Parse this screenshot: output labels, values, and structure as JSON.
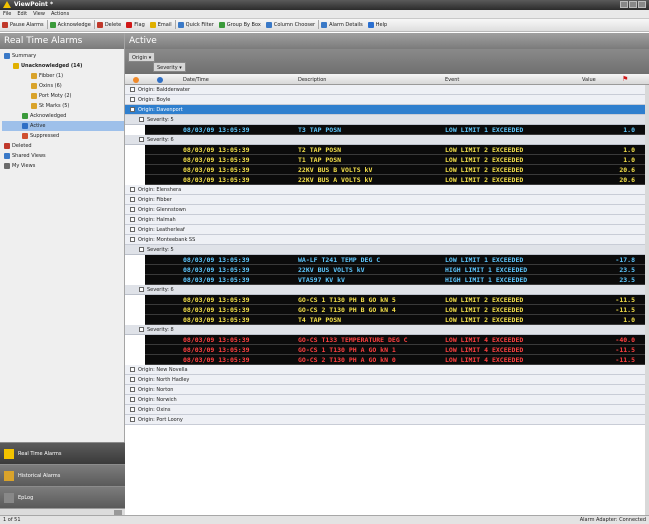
{
  "window": {
    "title": "ViewPoint *"
  },
  "menu": [
    "File",
    "Edit",
    "View",
    "Actions"
  ],
  "toolbar": [
    {
      "label": "Pause Alarms",
      "color": "#c0392b"
    },
    {
      "label": "Acknowledge",
      "color": "#3a9a3a"
    },
    {
      "label": "Delete",
      "color": "#c0392b"
    },
    {
      "label": "Flag",
      "color": "#d01818"
    },
    {
      "label": "Email",
      "color": "#e0b000"
    },
    {
      "label": "Quick Filter",
      "color": "#3a79c7"
    },
    {
      "label": "Group By Box",
      "color": "#3a9a3a"
    },
    {
      "label": "Column Chooser",
      "color": "#3a79c7"
    },
    {
      "label": "Alarm Details",
      "color": "#3a79c7"
    },
    {
      "label": "Help",
      "color": "#2a6fd0"
    }
  ],
  "left_panel": {
    "title": "Real Time Alarms",
    "tree": [
      {
        "label": "Summary",
        "indent": 0,
        "icon": "summary-icon",
        "color": "#3a79c7"
      },
      {
        "label": "Unacknowledged (14)",
        "indent": 1,
        "icon": "warning-icon",
        "color": "#e0b000",
        "bold": true
      },
      {
        "label": "Fibber (1)",
        "indent": 3,
        "icon": "folder-icon",
        "color": "#d9a32b"
      },
      {
        "label": "Oxins (6)",
        "indent": 3,
        "icon": "folder-icon",
        "color": "#d9a32b"
      },
      {
        "label": "Port Moty (2)",
        "indent": 3,
        "icon": "folder-icon",
        "color": "#d9a32b"
      },
      {
        "label": "St Marks (5)",
        "indent": 3,
        "icon": "folder-icon",
        "color": "#d9a32b"
      },
      {
        "label": "Acknowledged",
        "indent": 2,
        "icon": "check-icon",
        "color": "#3a9a3a"
      },
      {
        "label": "Active",
        "indent": 2,
        "icon": "star-icon",
        "color": "#2f6fc5",
        "selected": true
      },
      {
        "label": "Suppressed",
        "indent": 2,
        "icon": "suppressed-icon",
        "color": "#d05030"
      },
      {
        "label": "Deleted",
        "indent": 0,
        "icon": "deleted-icon",
        "color": "#c0392b"
      },
      {
        "label": "Shared Views",
        "indent": 0,
        "icon": "shared-icon",
        "color": "#3a79c7"
      },
      {
        "label": "My Views",
        "indent": 0,
        "icon": "views-icon",
        "color": "#6a6a6a"
      }
    ],
    "nav": [
      {
        "label": "Real Time Alarms",
        "icon": "warning-icon",
        "color": "#f2c200",
        "active": true
      },
      {
        "label": "Historical Alarms",
        "icon": "history-icon",
        "color": "#d9a32b"
      },
      {
        "label": "EpLog",
        "icon": "log-icon",
        "color": "#888888"
      }
    ]
  },
  "main": {
    "title": "Active",
    "group_chips": [
      "Origin",
      "Severity"
    ],
    "columns": [
      "Date/Time",
      "Description",
      "Event",
      "Value"
    ],
    "rows": [
      {
        "type": "origin",
        "label": "Origin: Baldderwater"
      },
      {
        "type": "origin",
        "label": "Origin: Boyle"
      },
      {
        "type": "origin",
        "label": "Origin: Davenport",
        "selected": true
      },
      {
        "type": "severity",
        "label": "Severity: 5"
      },
      {
        "type": "alarm",
        "datetime": "08/03/09 13:05:39",
        "desc": "T3 TAP POSN",
        "event": "LOW LIMIT 1 EXCEEDED",
        "value": "1.0",
        "color": "#5ec8ff"
      },
      {
        "type": "severity",
        "label": "Severity: 6"
      },
      {
        "type": "alarm",
        "datetime": "08/03/09 13:05:39",
        "desc": "T2 TAP POSN",
        "event": "LOW LIMIT 2 EXCEEDED",
        "value": "1.0",
        "color": "#f4e04a"
      },
      {
        "type": "alarm",
        "datetime": "08/03/09 13:05:39",
        "desc": "T1 TAP POSN",
        "event": "LOW LIMIT 2 EXCEEDED",
        "value": "1.0",
        "color": "#f4e04a"
      },
      {
        "type": "alarm",
        "datetime": "08/03/09 13:05:39",
        "desc": "22KV BUS B VOLTS kV",
        "event": "LOW LIMIT 2 EXCEEDED",
        "value": "20.6",
        "color": "#f4e04a"
      },
      {
        "type": "alarm",
        "datetime": "08/03/09 13:05:39",
        "desc": "22KV BUS A VOLTS kV",
        "event": "LOW LIMIT 2 EXCEEDED",
        "value": "20.6",
        "color": "#f4e04a"
      },
      {
        "type": "origin",
        "label": "Origin: Elenshera"
      },
      {
        "type": "origin",
        "label": "Origin: Fibber"
      },
      {
        "type": "origin",
        "label": "Origin: Glennstown"
      },
      {
        "type": "origin",
        "label": "Origin: Halmah"
      },
      {
        "type": "origin",
        "label": "Origin: Leatherleaf"
      },
      {
        "type": "origin",
        "label": "Origin: Monteebank SS"
      },
      {
        "type": "severity",
        "label": "Severity: 5"
      },
      {
        "type": "alarm",
        "datetime": "08/03/09 13:05:39",
        "desc": "WA-LF T241 TEMP DEG C",
        "event": "LOW LIMIT 1 EXCEEDED",
        "value": "-17.8",
        "color": "#5ec8ff"
      },
      {
        "type": "alarm",
        "datetime": "08/03/09 13:05:39",
        "desc": "22KV BUS VOLTS kV",
        "event": "HIGH LIMIT 1 EXCEEDED",
        "value": "23.5",
        "color": "#5ec8ff"
      },
      {
        "type": "alarm",
        "datetime": "08/03/09 13:05:39",
        "desc": "VTA597 KV kV",
        "event": "HIGH LIMIT 1 EXCEEDED",
        "value": "23.5",
        "color": "#5ec8ff"
      },
      {
        "type": "severity",
        "label": "Severity: 6"
      },
      {
        "type": "alarm",
        "datetime": "08/03/09 13:05:39",
        "desc": "GO-CS 1 T130 PH B GO kN 5",
        "event": "LOW LIMIT 2 EXCEEDED",
        "value": "-11.5",
        "color": "#f4e04a"
      },
      {
        "type": "alarm",
        "datetime": "08/03/09 13:05:39",
        "desc": "GO-CS 2 T130 PH B GO kN 4",
        "event": "LOW LIMIT 2 EXCEEDED",
        "value": "-11.5",
        "color": "#f4e04a"
      },
      {
        "type": "alarm",
        "datetime": "08/03/09 13:05:39",
        "desc": "T4 TAP POSN",
        "event": "LOW LIMIT 2 EXCEEDED",
        "value": "1.0",
        "color": "#f4e04a"
      },
      {
        "type": "severity",
        "label": "Severity: 8"
      },
      {
        "type": "alarm",
        "datetime": "08/03/09 13:05:39",
        "desc": "GO-CS T133 TEMPERATURE DEG C",
        "event": "LOW LIMIT 4 EXCEEDED",
        "value": "-40.0",
        "color": "#ff4040"
      },
      {
        "type": "alarm",
        "datetime": "08/03/09 13:05:39",
        "desc": "GO-CS 1 T130 PH A GO kN 1",
        "event": "LOW LIMIT 4 EXCEEDED",
        "value": "-11.5",
        "color": "#ff4040"
      },
      {
        "type": "alarm",
        "datetime": "08/03/09 13:05:39",
        "desc": "GO-CS 2 T130 PH A GO kN 0",
        "event": "LOW LIMIT 4 EXCEEDED",
        "value": "-11.5",
        "color": "#ff4040"
      },
      {
        "type": "origin",
        "label": "Origin: New Novella"
      },
      {
        "type": "origin",
        "label": "Origin: North Hadley"
      },
      {
        "type": "origin",
        "label": "Origin: Norton"
      },
      {
        "type": "origin",
        "label": "Origin: Norwich"
      },
      {
        "type": "origin",
        "label": "Origin: Oxins"
      },
      {
        "type": "origin",
        "label": "Origin: Port Loony"
      }
    ]
  },
  "status": {
    "left": "1 of 51",
    "right": "Alarm Adapter: Connected"
  }
}
